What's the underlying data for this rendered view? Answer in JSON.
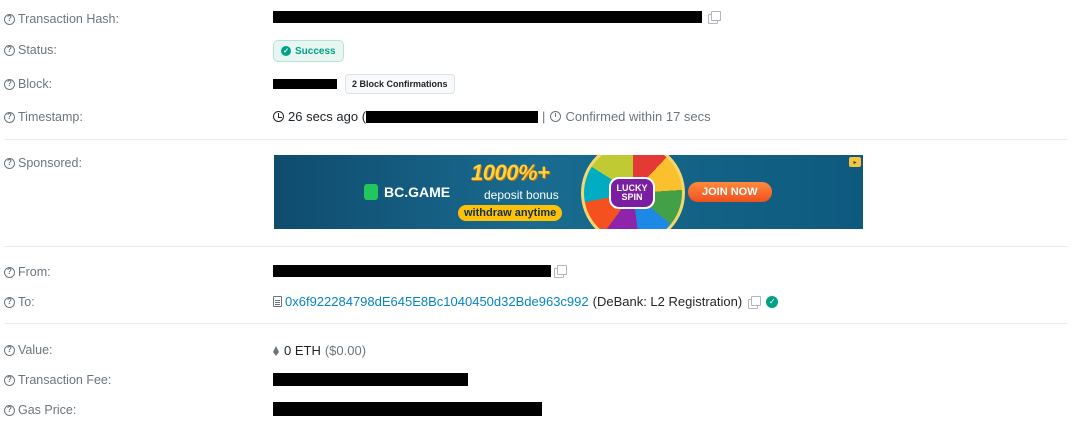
{
  "labels": {
    "tx_hash": "Transaction Hash:",
    "status": "Status:",
    "block": "Block:",
    "timestamp": "Timestamp:",
    "sponsored": "Sponsored:",
    "from": "From:",
    "to": "To:",
    "value": "Value:",
    "fee": "Transaction Fee:",
    "gas_price": "Gas Price:"
  },
  "status": {
    "text": "Success"
  },
  "block": {
    "confirmations": "2 Block Confirmations"
  },
  "timestamp": {
    "ago": "26 secs ago (",
    "sep": "|",
    "confirmed": "Confirmed within 17 secs"
  },
  "ad": {
    "brand": "BC.GAME",
    "headline": "1000%+",
    "subline": "deposit bonus",
    "tag": "withdraw anytime",
    "wheel_text_line1": "LUCKY",
    "wheel_text_line2": "SPIN",
    "cta": "JOIN NOW"
  },
  "to": {
    "address": "0x6f922284798dE645E8Bc1040450d32Bde963c992",
    "name": "(DeBank: L2 Registration)"
  },
  "value": {
    "amount": "0 ETH",
    "usd": "($0.00)"
  },
  "icons": {
    "help": "question-circle-icon",
    "copy": "copy-icon",
    "success": "check-circle-icon",
    "clock": "clock-icon",
    "stopwatch": "stopwatch-icon",
    "contract": "file-contract-icon",
    "verified": "verified-check-icon",
    "eth": "ethereum-icon"
  },
  "colors": {
    "success": "#00a186",
    "link": "#0784c3",
    "muted": "#6c757d"
  }
}
